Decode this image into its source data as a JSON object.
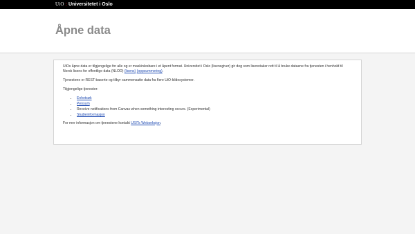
{
  "topbar": {
    "logo_text": "UiO",
    "separator": ":",
    "institution": "Universitetet i Oslo"
  },
  "header": {
    "title": "Åpne data"
  },
  "intro": {
    "text": "UiOs åpne data er tilgjengelige for alle og er maskinlesbare i et åpent format. Universitet i Oslo (lisensgiver) gir deg som lisenstaker rett til å bruke dataene fra tjenesten i henhold til Norsk lisens for offentlige data (NLOD) ",
    "license_link": "(lisens)",
    "summary_link": "(oppsummering)",
    "end": "."
  },
  "services_text": "Tjenestene er REST-baserte og tilbyr sammensatte data fra flere UiO-kildesystemer.",
  "available_label": "Tilgjengelige tjenester:",
  "services": [
    {
      "label": "Enhetsøk",
      "link": true
    },
    {
      "label": "Pensum",
      "link": true
    },
    {
      "label": "Receive notifications from Canvas when something interesting occurs. (Experimental)",
      "link": false
    },
    {
      "label": "Studieinformasjon",
      "link": true
    }
  ],
  "contact": {
    "text": "For mer informasjon om tjenestene kontakt ",
    "link": "USITs Webseksjon",
    "end": "."
  }
}
